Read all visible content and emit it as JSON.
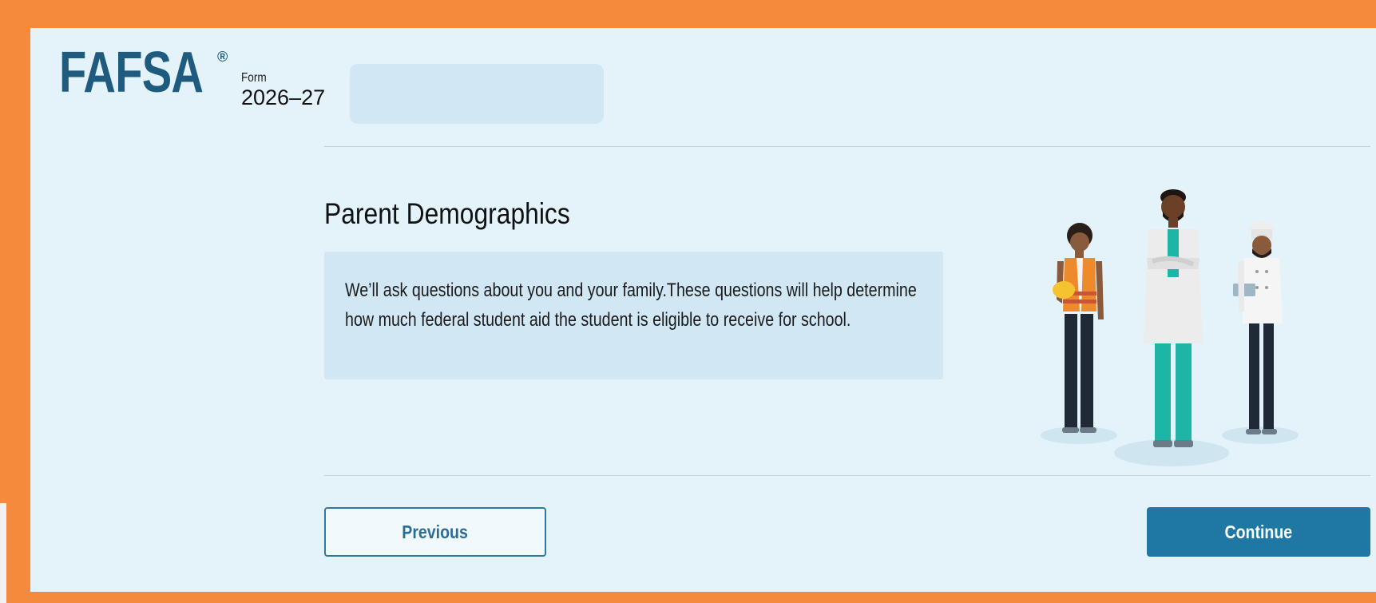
{
  "header": {
    "logo_text": "FAFSA",
    "logo_reg": "®",
    "form_label": "Form",
    "form_year": "2026–27"
  },
  "section": {
    "title": "Parent Demographics",
    "description": "We’ll ask questions about you and your family.These questions will help determine how much federal student aid the student is eligible to receive for school."
  },
  "illustration": {
    "icon": "workers-illustration"
  },
  "navigation": {
    "previous_label": "Previous",
    "continue_label": "Continue"
  },
  "colors": {
    "border": "#f58a3c",
    "background": "#e4f3fa",
    "brand": "#1e5b7f",
    "primary_button": "#1f77a3",
    "info_box": "#d1e8f4"
  }
}
